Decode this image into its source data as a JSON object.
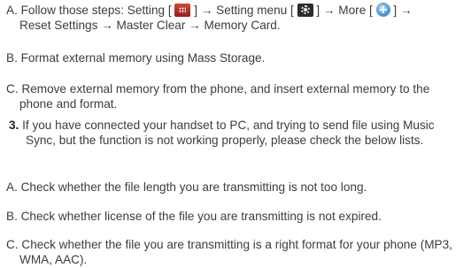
{
  "itemA1": {
    "prefix": "A. Follow those steps: Setting [",
    "mid1": "] → Setting menu [",
    "mid2": "] → More [",
    "mid3": "] →",
    "line2": "Reset Settings → Master Clear → Memory Card."
  },
  "itemB1": "B. Format external memory using Mass Storage.",
  "itemC1": "C. Remove external memory from the phone, and insert external memory to the phone and format.",
  "item3": {
    "number": "3.",
    "text": "If you have connected your handset to PC, and trying to send file using Music Sync, but the function is not working properly, please check the below lists."
  },
  "itemA2": "A. Check whether the file length you are transmitting is not too long.",
  "itemB2": "B. Check whether license of the file you are transmitting is not expired.",
  "itemC2": "C. Check whether the file you are transmitting is a right format for your phone (MP3, WMA, AAC).",
  "icons": [
    "apps-icon",
    "settings-gear-icon",
    "plus-icon"
  ]
}
